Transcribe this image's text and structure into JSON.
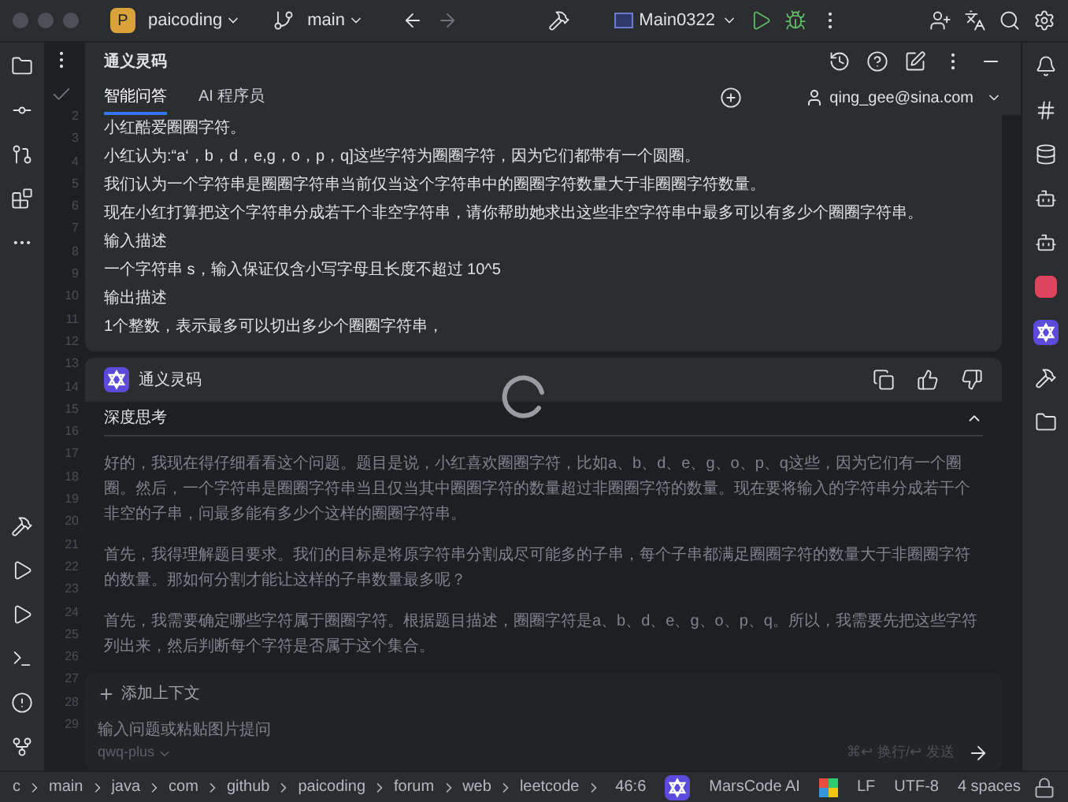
{
  "title_bar": {
    "project_badge": "P",
    "project": "paicoding",
    "branch": "main",
    "run_config": "Main0322"
  },
  "gutter": {
    "line_numbers": [
      "2",
      "3",
      "4",
      "5",
      "6",
      "7",
      "8",
      "9",
      "10",
      "11",
      "12",
      "13",
      "14",
      "15",
      "16",
      "17",
      "18",
      "19",
      "20",
      "21",
      "22",
      "23",
      "24",
      "25",
      "26",
      "27",
      "28",
      "29"
    ]
  },
  "panel": {
    "title": "通义灵码",
    "tabs": [
      {
        "label": "智能问答",
        "selected": true
      },
      {
        "label": "AI 程序员",
        "selected": false
      }
    ],
    "account": "qing_gee@sina.com",
    "question": [
      "小红酷爱圈圈字符。",
      "小红认为:“a‘，b，d，e,g，o，p，q]这些字符为圈圈字符，因为它们都带有一个圆圈。",
      "我们认为一个字符串是圈圈字符串当前仅当这个字符串中的圈圈字符数量大于非圈圈字符数量。",
      "现在小红打算把这个字符串分成若干个非空字符串，请你帮助她求出这些非空字符串中最多可以有多少个圈圈字符串。",
      "输入描述",
      "一个字符串 s，输入保证仅含小写字母且长度不超过 10^5",
      "输出描述",
      "1个整数，表示最多可以切出多少个圈圈字符串，"
    ],
    "answer": {
      "author": "通义灵码",
      "loading": true,
      "thinking": {
        "title": "深度思考",
        "expanded": true,
        "paragraphs": [
          "好的，我现在得仔细看看这个问题。题目是说，小红喜欢圈圈字符，比如a、b、d、e、g、o、p、q这些，因为它们有一个圈圈。然后，一个字符串是圈圈字符串当且仅当其中圈圈字符的数量超过非圈圈字符的数量。现在要将输入的字符串分成若干个非空的子串，问最多能有多少个这样的圈圈字符串。",
          "首先，我得理解题目要求。我们的目标是将原字符串分割成尽可能多的子串，每个子串都满足圈圈字符的数量大于非圈圈字符的数量。那如何分割才能让这样的子串数量最多呢？",
          "首先，我需要确定哪些字符属于圈圈字符。根据题目描述，圈圈字符是a、b、d、e、g、o、p、q。所以，我需要先把这些字符列出来，然后判断每个字符是否属于这个集合。"
        ]
      }
    },
    "input": {
      "add_context": "添加上下文",
      "placeholder": "输入问题或粘贴图片提问",
      "model": "qwq-plus",
      "hint": "⌘↩ 换行/↩ 发送"
    }
  },
  "status_bar": {
    "breadcrumbs": [
      "c",
      "main",
      "java",
      "com",
      "github",
      "paicoding",
      "forum",
      "web",
      "leetcode"
    ],
    "position": "46:6",
    "plugin": "MarsCode AI",
    "line_ending": "LF",
    "encoding": "UTF-8",
    "indent": "4 spaces"
  }
}
